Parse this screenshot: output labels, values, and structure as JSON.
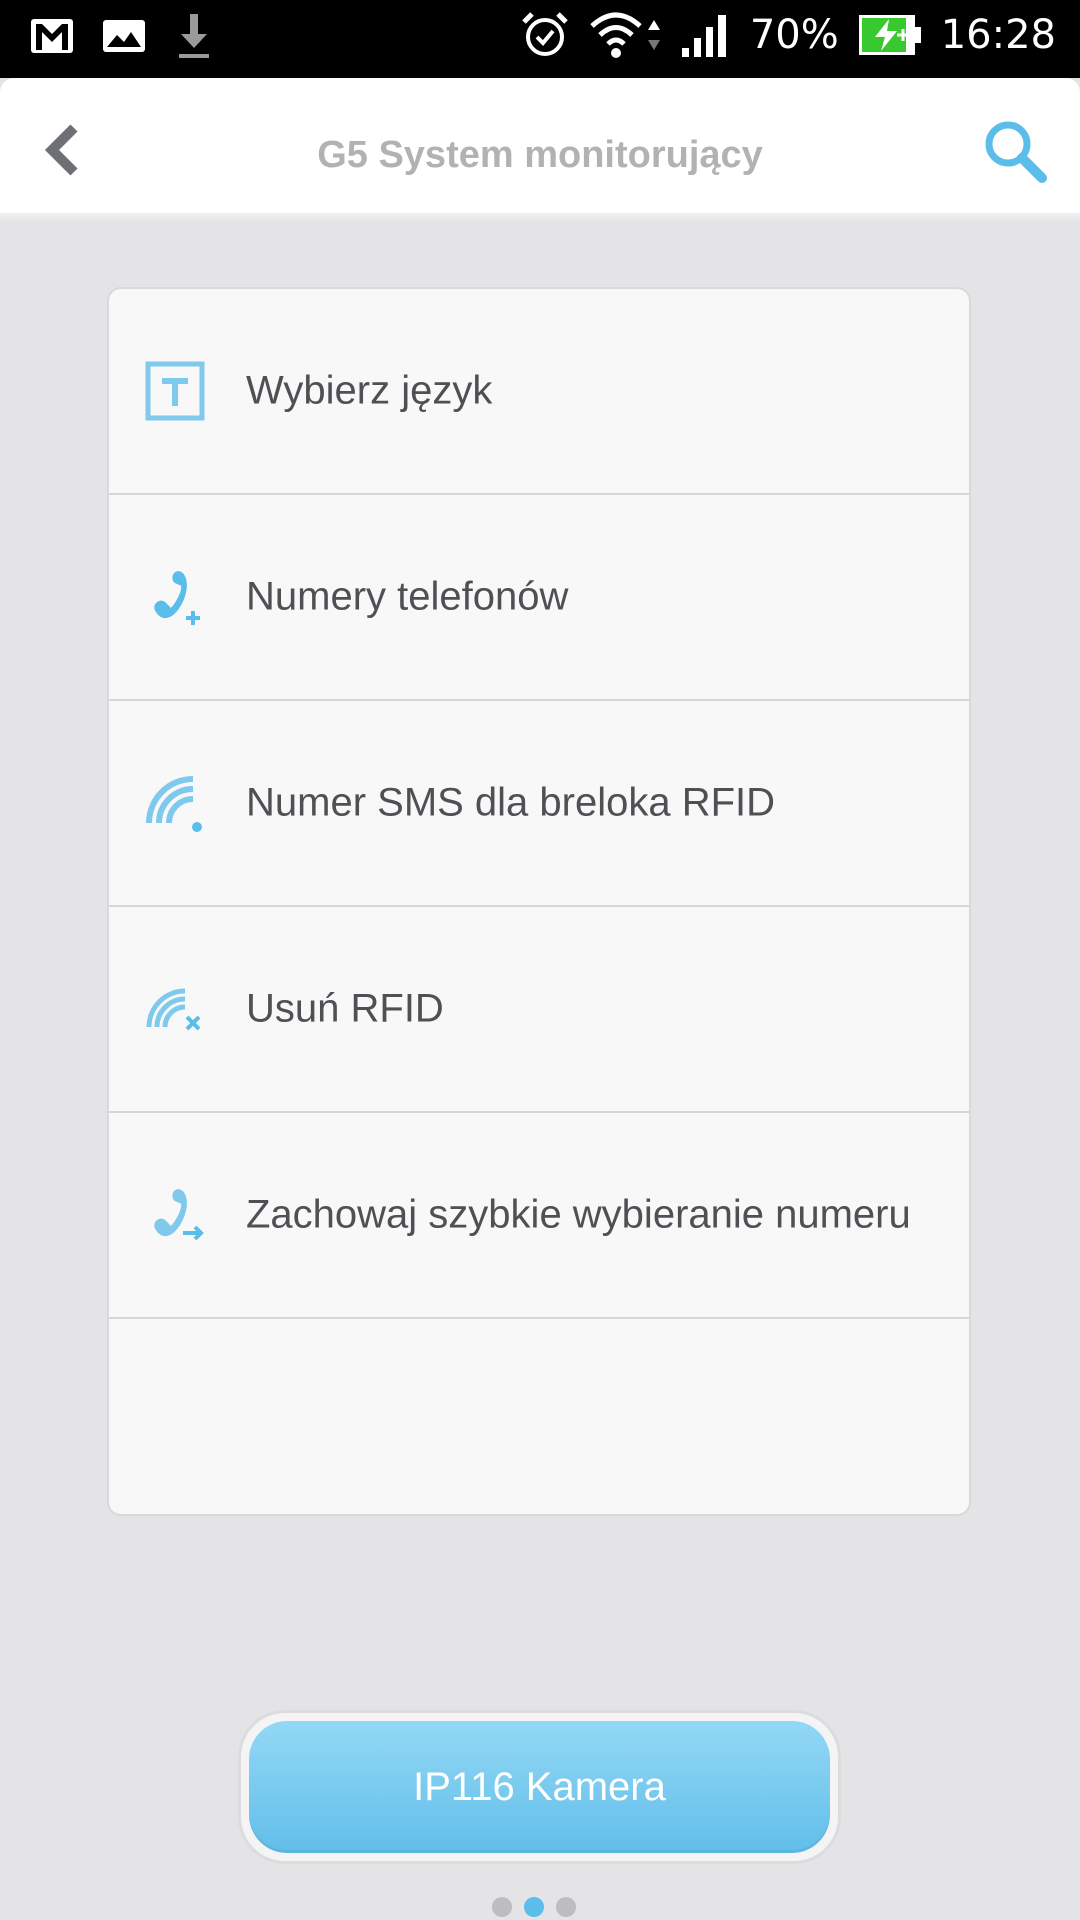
{
  "status_bar": {
    "battery_percent": "70%",
    "time": "16:28",
    "icons": [
      "gmail-icon",
      "gallery-icon",
      "download-icon",
      "alarm-icon",
      "wifi-icon",
      "signal-icon",
      "battery-charging-icon"
    ]
  },
  "header": {
    "title": "G5 System monitorujący",
    "back_icon": "chevron-left-icon",
    "search_icon": "search-icon"
  },
  "menu": {
    "items": [
      {
        "label": "Wybierz język",
        "icon": "language-icon"
      },
      {
        "label": "Numery telefonów",
        "icon": "phone-add-icon"
      },
      {
        "label": "Numer SMS dla breloka RFID",
        "icon": "rfid-icon"
      },
      {
        "label": "Usuń RFID",
        "icon": "rfid-delete-icon"
      },
      {
        "label": "Zachowaj szybkie wybieranie numeru",
        "icon": "phone-forward-icon"
      }
    ]
  },
  "footer": {
    "button_label": "IP116 Kamera",
    "pager": {
      "count": 3,
      "active_index": 1
    }
  },
  "colors": {
    "accent": "#5bbde9",
    "background": "#e4e4e6",
    "title": "#b2b2b4",
    "text": "#505054"
  }
}
